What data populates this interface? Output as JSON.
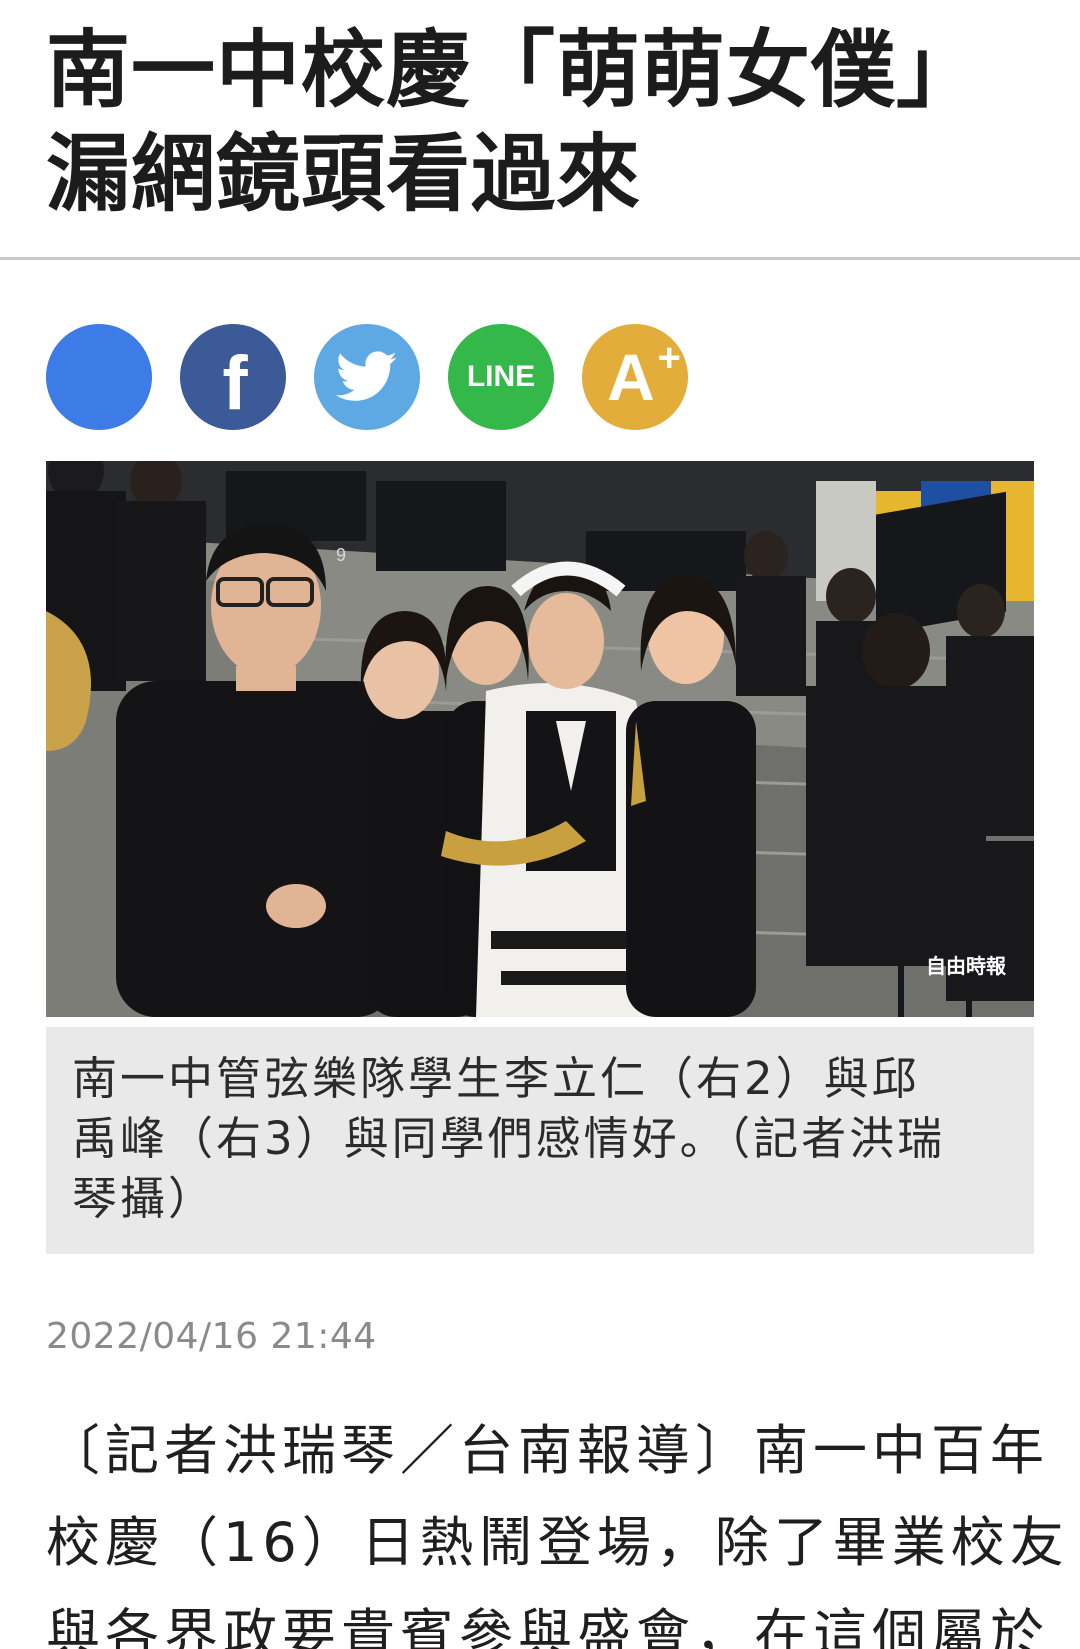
{
  "article": {
    "headline_line1": "南一中校慶「萌萌女僕」",
    "headline_line2": "漏網鏡頭看過來",
    "photo_watermark": "自由時報",
    "photo_numeral": "9",
    "caption_line1": "南一中管弦樂隊學生李立仁（右2）與邱",
    "caption_line2": "禹峰（右3）與同學們感情好。（記者洪瑞",
    "caption_line3": "琴攝）",
    "timestamp": "2022/04/16 21:44",
    "body_line1": "〔記者洪瑞琴／台南報導〕南一中百年",
    "body_line2": "校慶（16）日熱鬧登場，除了畢業校友",
    "body_line3": "與各界政要貴賓參與盛會，在這個屬於"
  },
  "share": {
    "line_label": "LINE",
    "font_label": "A",
    "font_plus": "+",
    "facebook_label": "f"
  },
  "colors": {
    "share_blue": "#3d7be6",
    "facebook": "#3c5998",
    "twitter": "#5ea9e3",
    "line": "#35b84a",
    "font_size": "#e3ad3b",
    "caption_bg": "#e9e9e9"
  },
  "icons": [
    "share-icon",
    "facebook-icon",
    "twitter-icon",
    "line-icon",
    "font-size-icon"
  ]
}
